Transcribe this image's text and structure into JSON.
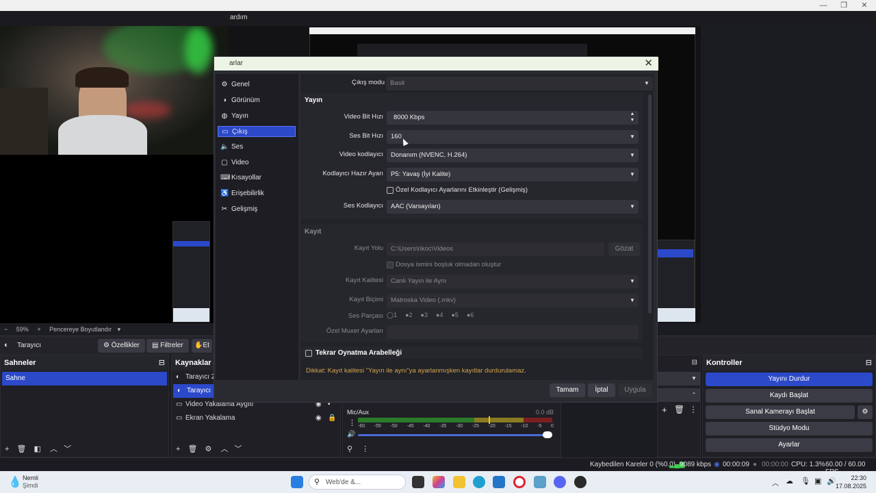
{
  "window": {
    "menu_fragment": "ardım"
  },
  "preview": {
    "zoom": "59%",
    "fit_label": "Pencereye Boyutlandır"
  },
  "source_toolbar": {
    "selected_source": "Tarayıcı",
    "properties": "Özellikler",
    "filters": "Filtreler",
    "third": "Et"
  },
  "scenes": {
    "title": "Sahneler",
    "items": [
      "Sahne"
    ]
  },
  "sources": {
    "title": "Kaynaklar",
    "items": [
      "Tarayıcı 2",
      "Tarayıcı",
      "Video Yakalama Aygıtı",
      "Ekran Yakalama"
    ]
  },
  "audio": {
    "channel": "Mic/Aux",
    "db": "0.0 dB",
    "ticks": [
      "-60",
      "-55",
      "-50",
      "-45",
      "-40",
      "-35",
      "-30",
      "-25",
      "-20",
      "-15",
      "-10",
      "-5",
      "0"
    ]
  },
  "controls": {
    "title": "Kontroller",
    "buttons": [
      "Yayını Durdur",
      "Kaydı Başlat",
      "Sanal Kamerayı Başlat",
      "Stüdyo Modu",
      "Ayarlar"
    ]
  },
  "status": {
    "dropped": "Kaybedilen Kareler 0 (%0.0)",
    "bitrate": "9089 kbps",
    "stream_time": "00:00:09",
    "rec_time": "00:00:00",
    "cpu": "CPU: 1.3%",
    "fps": "60.00 / 60.00 FPS"
  },
  "taskbar": {
    "weather_title": "Nemli",
    "weather_sub": "Şimdi",
    "search": "Web'de &...",
    "time": "22:30",
    "date": "17.08.2025"
  },
  "settings": {
    "title": "arlar",
    "nav": [
      "Genel",
      "Görünüm",
      "Yayın",
      "Çıkış",
      "Ses",
      "Video",
      "Kısayollar",
      "Erişebilirlik",
      "Gelişmiş"
    ],
    "output_mode_label": "Çıkış modu",
    "output_mode": "Basit",
    "stream_section": "Yayın",
    "video_bitrate_label": "Video Bit Hızı",
    "video_bitrate": "8000 Kbps",
    "audio_bitrate_label": "Ses Bit Hızı",
    "audio_bitrate": "160",
    "video_encoder_label": "Video kodlayıcı",
    "video_encoder": "Donanım (NVENC, H.264)",
    "preset_label": "Kodlayıcı Hazır Ayarı",
    "preset": "P5: Yavaş (İyi Kalite)",
    "custom_encoder": "Özel Kodlayıcı Ayarlarını Etkinleştir (Gelişmiş)",
    "audio_encoder_label": "Ses Kodlayıcı",
    "audio_encoder": "AAC (Varsayılan)",
    "record_section": "Kayıt",
    "rec_path_label": "Kayıt Yolu",
    "rec_path": "C:\\Users\\rikoc\\Videos",
    "browse": "Gözat",
    "no_space": "Dosya ismini boşluk olmadan oluştur",
    "rec_quality_label": "Kayıt Kalitesi",
    "rec_quality": "Canlı Yayın ile Aynı",
    "rec_format_label": "Kayıt Biçimi",
    "rec_format": "Matroska Video (.mkv)",
    "tracks_label": "Ses Parçası",
    "tracks": [
      "1",
      "2",
      "3",
      "4",
      "5",
      "6"
    ],
    "muxer_label": "Özel Muxer Ayarları",
    "replay_buffer": "Tekrar Oynatma Arabelleği",
    "warning": "Dikkat: Kayıt kalitesi \"Yayın ile aynı\"ya ayarlanmışken kayıtlar durdurulamaz.",
    "ok": "Tamam",
    "cancel": "İptal",
    "apply": "Uygula"
  },
  "colors": {
    "accent": "#2b49c9",
    "warning": "#d4a64a"
  }
}
